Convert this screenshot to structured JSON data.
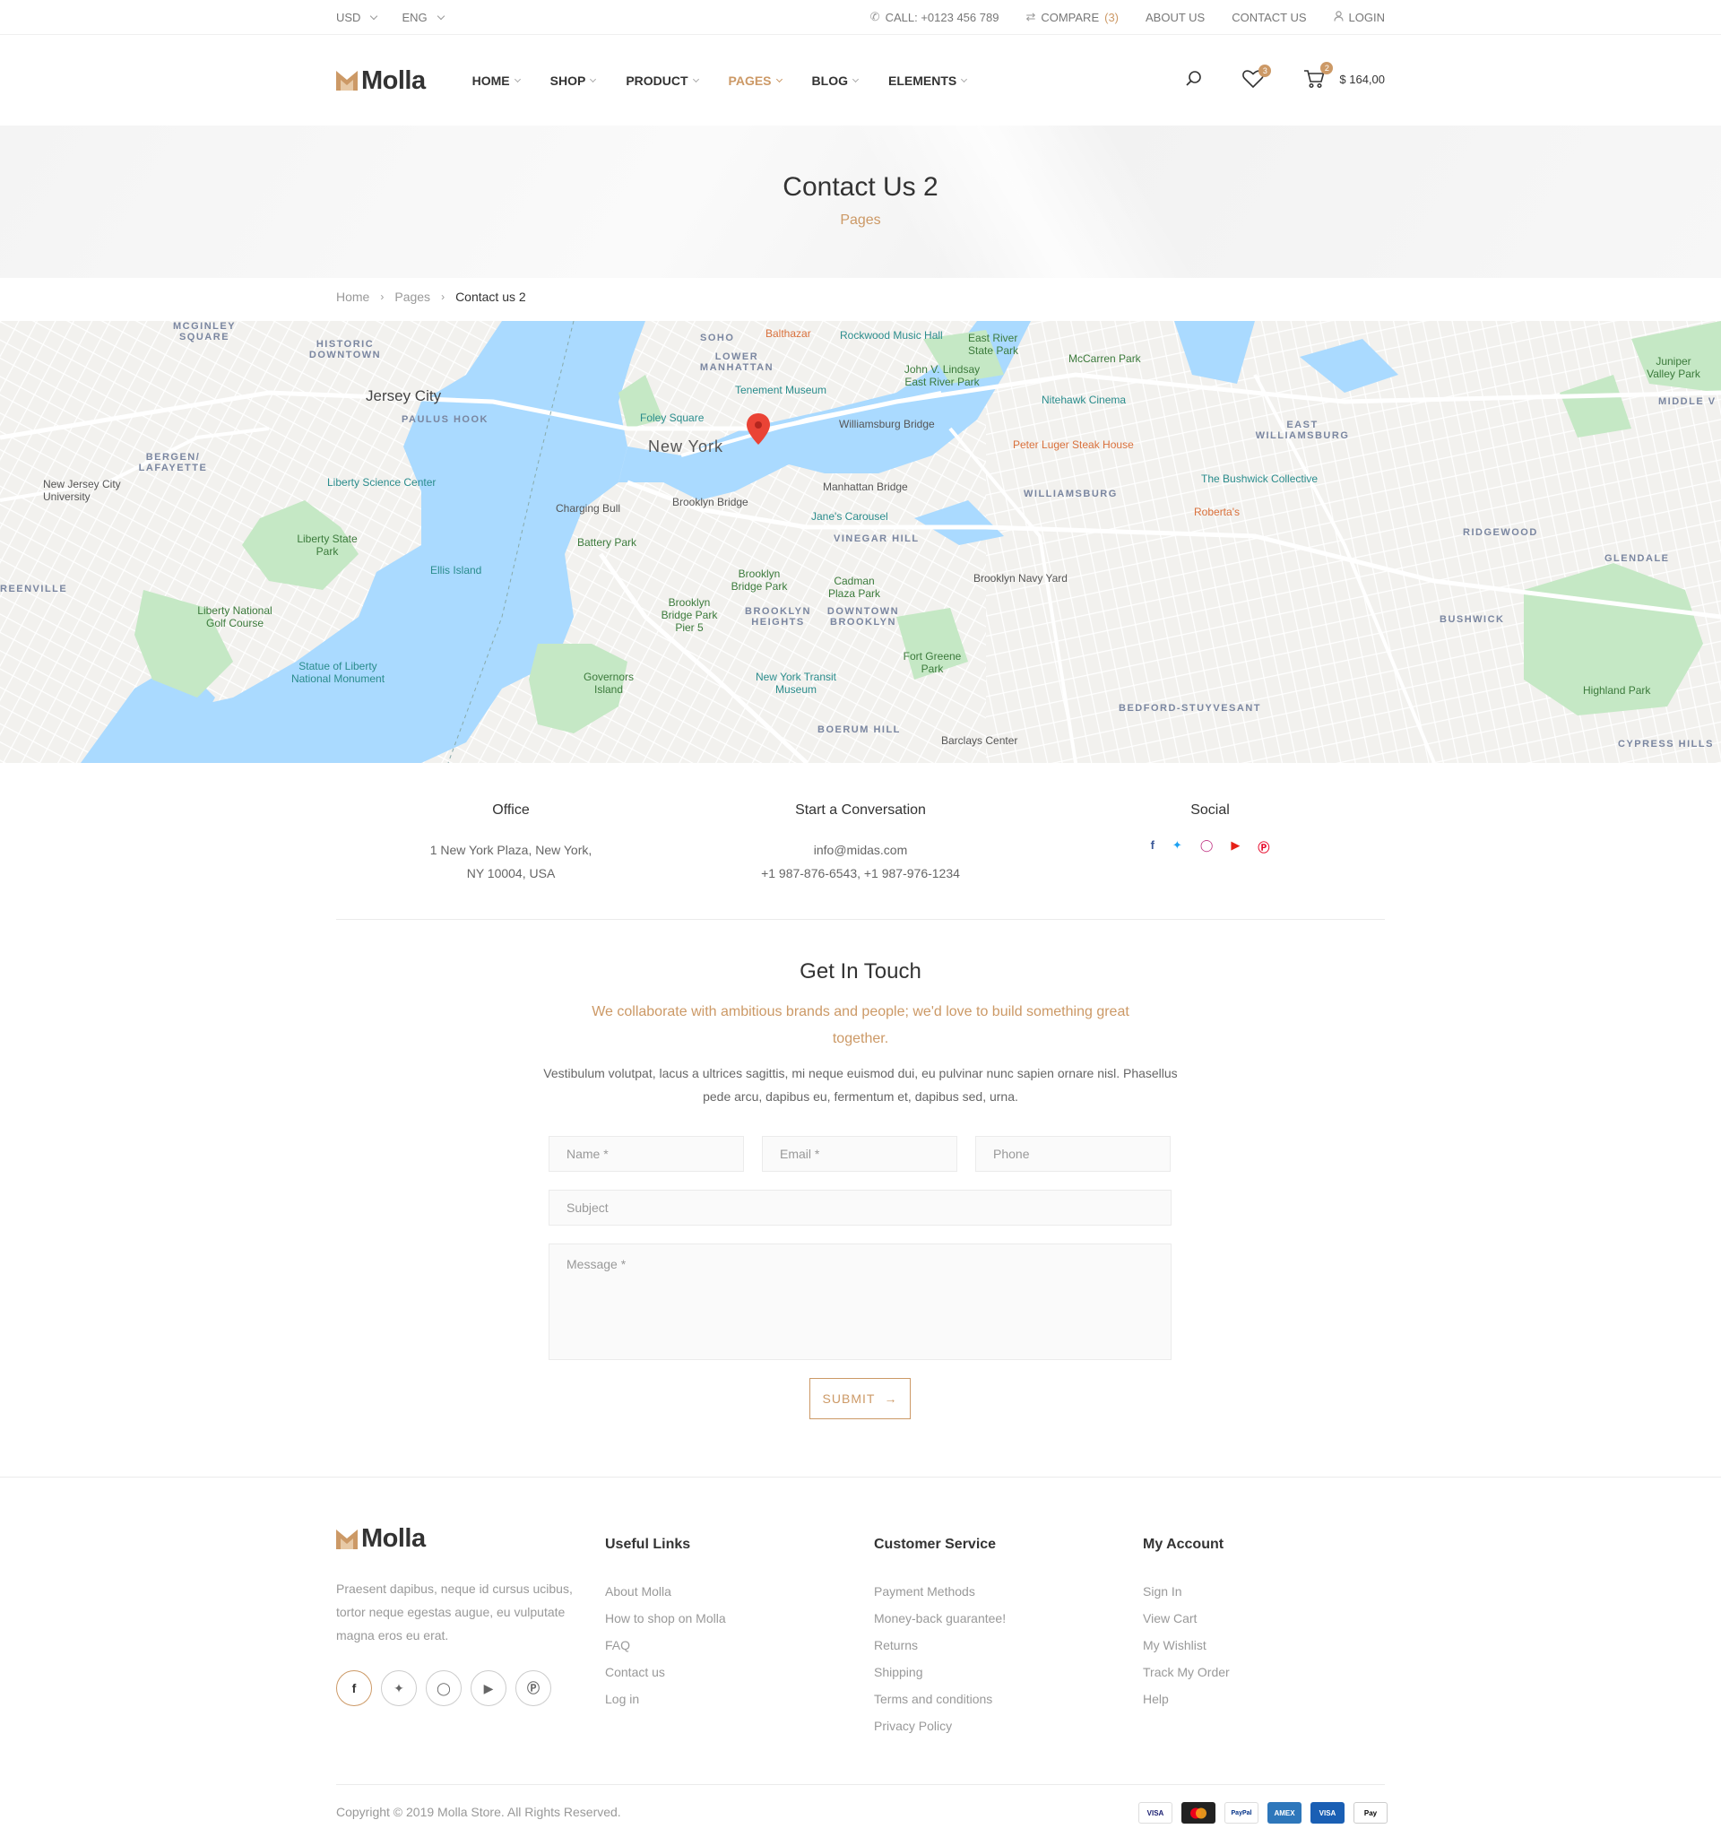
{
  "topbar": {
    "currency": "USD",
    "language": "ENG",
    "call": "CALL: +0123 456 789",
    "compare_label": "COMPARE",
    "compare_count": "(3)",
    "about": "ABOUT US",
    "contact": "CONTACT US",
    "login": "LOGIN"
  },
  "header": {
    "logo_text": "Molla",
    "nav": [
      "HOME",
      "SHOP",
      "PRODUCT",
      "PAGES",
      "BLOG",
      "ELEMENTS"
    ],
    "active_nav": "PAGES",
    "wishlist_count": "3",
    "cart_count": "2",
    "cart_total": "$ 164,00"
  },
  "page_header": {
    "title": "Contact Us 2",
    "subtitle": "Pages"
  },
  "breadcrumb": {
    "home": "Home",
    "pages": "Pages",
    "current": "Contact us 2"
  },
  "map": {
    "labels": {
      "new_york": "New York",
      "jersey_city": "Jersey City",
      "williamsburg": "WILLIAMSBURG",
      "east_williamsburg": "EAST WILLIAMSBURG",
      "bushwick": "BUSHWICK",
      "ridgewood": "RIDGEWOOD",
      "glendale": "GLENDALE",
      "bed_stuy": "BEDFORD-STUYVESANT",
      "vinegar_hill": "VINEGAR HILL",
      "brooklyn_heights": "BROOKLYN HEIGHTS",
      "downtown_brooklyn": "DOWNTOWN BROOKLYN",
      "boerum_hill": "BOERUM HILL",
      "soho": "SOHO",
      "lower_manhattan": "LOWER MANHATTAN",
      "historic_downtown": "HISTORIC DOWNTOWN",
      "paulus_hook": "PAULUS HOOK",
      "bergen_lafayette": "BERGEN/ LAFAYETTE",
      "mcginley_square": "MCGINLEY SQUARE",
      "greenville": "REENVILLE",
      "cypress_hills": "CYPRESS HILLS",
      "middle_village": "MIDDLE V",
      "liberty_state_park": "Liberty State Park",
      "liberty_science_center": "Liberty Science Center",
      "ellis_island": "Ellis Island",
      "statue_of_liberty": "Statue of Liberty National Monument",
      "governors_island": "Governors Island",
      "liberty_national": "Liberty National Golf Course",
      "njcu": "New Jersey City University",
      "battery_park": "Battery Park",
      "charging_bull": "Charging Bull",
      "brooklyn_bridge": "Brooklyn Bridge",
      "manhattan_bridge": "Manhattan Bridge",
      "williamsburg_bridge": "Williamsburg Bridge",
      "janes_carousel": "Jane's Carousel",
      "brooklyn_bridge_park": "Brooklyn Bridge Park",
      "bb_park_pier5": "Brooklyn Bridge Park Pier 5",
      "cadman_plaza": "Cadman Plaza Park",
      "fort_greene": "Fort Greene Park",
      "transit_museum": "New York Transit Museum",
      "barclays": "Barclays Center",
      "navy_yard": "Brooklyn Navy Yard",
      "tenement_museum": "Tenement Museum",
      "foley_square": "Foley Square",
      "balthazar": "Balthazar",
      "rockwood": "Rockwood Music Hall",
      "john_v_lindsay": "John V. Lindsay East River Park",
      "east_river_state_park": "East River State Park",
      "mccarren_park": "McCarren Park",
      "nitehawk": "Nitehawk Cinema",
      "peter_luger": "Peter Luger Steak House",
      "bushwick_collective": "The Bushwick Collective",
      "robertas": "Roberta's",
      "juniper_valley": "Juniper Valley Park",
      "highland_park": "Highland Park"
    }
  },
  "info": {
    "office_title": "Office",
    "office_line1": "1 New York Plaza, New York,",
    "office_line2": "NY 10004, USA",
    "conv_title": "Start a Conversation",
    "email": "info@midas.com",
    "phones": "+1 987-876-6543, +1 987-976-1234",
    "social_title": "Social",
    "social_icons": [
      "facebook-icon",
      "twitter-icon",
      "instagram-icon",
      "youtube-icon",
      "pinterest-icon"
    ]
  },
  "contact": {
    "title": "Get In Touch",
    "lead": "We collaborate with ambitious brands and people; we'd love to build something great together.",
    "body": "Vestibulum volutpat, lacus a ultrices sagittis, mi neque euismod dui, eu pulvinar nunc sapien ornare nisl. Phasellus pede arcu, dapibus eu, fermentum et, dapibus sed, urna.",
    "name_placeholder": "Name *",
    "email_placeholder": "Email *",
    "phone_placeholder": "Phone",
    "subject_placeholder": "Subject",
    "message_placeholder": "Message *",
    "submit": "SUBMIT"
  },
  "footer": {
    "logo_text": "Molla",
    "description": "Praesent dapibus, neque id cursus ucibus, tortor neque egestas augue, eu vulputate magna eros eu erat.",
    "useful_title": "Useful Links",
    "useful_links": [
      "About Molla",
      "How to shop on Molla",
      "FAQ",
      "Contact us",
      "Log in"
    ],
    "service_title": "Customer Service",
    "service_links": [
      "Payment Methods",
      "Money-back guarantee!",
      "Returns",
      "Shipping",
      "Terms and conditions",
      "Privacy Policy"
    ],
    "account_title": "My Account",
    "account_links": [
      "Sign In",
      "View Cart",
      "My Wishlist",
      "Track My Order",
      "Help"
    ],
    "copyright": "Copyright © 2019 Molla Store. All Rights Reserved.",
    "payments": [
      "VISA",
      "mastercard",
      "PayPal",
      "AMEX",
      "VISA",
      "Pay"
    ]
  },
  "colors": {
    "accent": "#cc9966",
    "map_water": "#aadaff",
    "map_park": "#c5e8c5"
  }
}
